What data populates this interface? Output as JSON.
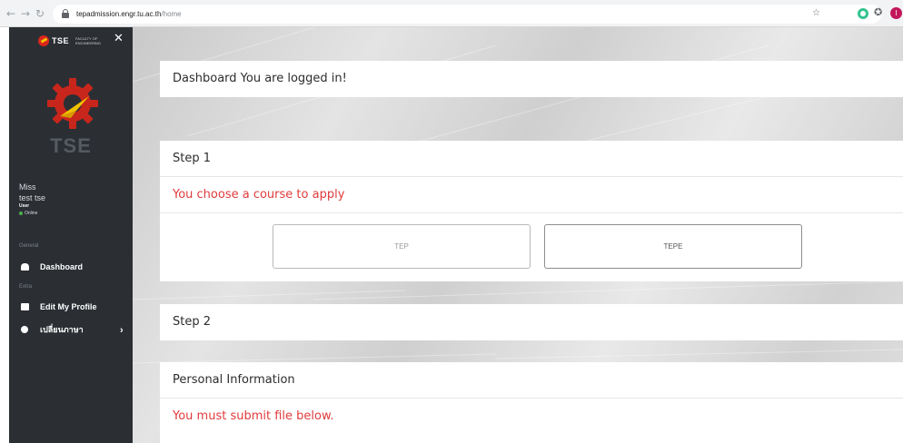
{
  "browser": {
    "url_host": "tepadmission.engr.tu.ac.th",
    "url_path": "/home",
    "profile_initial": "I",
    "icons": [
      "back-icon",
      "forward-icon",
      "reload-icon",
      "lock-icon",
      "star-icon",
      "extension-icon",
      "puzzle-icon",
      "profile-avatar"
    ]
  },
  "sidebar": {
    "brand": "TSE",
    "brand_sub": "FACULTY OF ENGINEERING",
    "hero_text": "TSE",
    "user": {
      "title": "Miss",
      "name": "test  tse",
      "role": "User",
      "status": "Online"
    },
    "sections": {
      "general": "General",
      "extra": "Extra"
    },
    "items": [
      {
        "label": "Dashboard",
        "icon": "dashboard-icon"
      },
      {
        "label": "Edit My Profile",
        "icon": "folder-icon"
      },
      {
        "label": "เปลี่ยนภาษา",
        "icon": "globe-icon"
      }
    ],
    "colors": {
      "background": "#2b2f34",
      "logo_red": "#d9261c",
      "logo_yellow": "#f2c200"
    }
  },
  "main": {
    "dashboard_title": "Dashboard You are logged in!",
    "step1": {
      "title": "Step 1",
      "alert": "You choose a course to apply",
      "courses": [
        "TEP",
        "TEPE"
      ]
    },
    "step2": {
      "title": "Step 2"
    },
    "personal": {
      "title": "Personal Information",
      "alert": "You must submit file below."
    },
    "colors": {
      "alert": "#e03b3b"
    }
  }
}
